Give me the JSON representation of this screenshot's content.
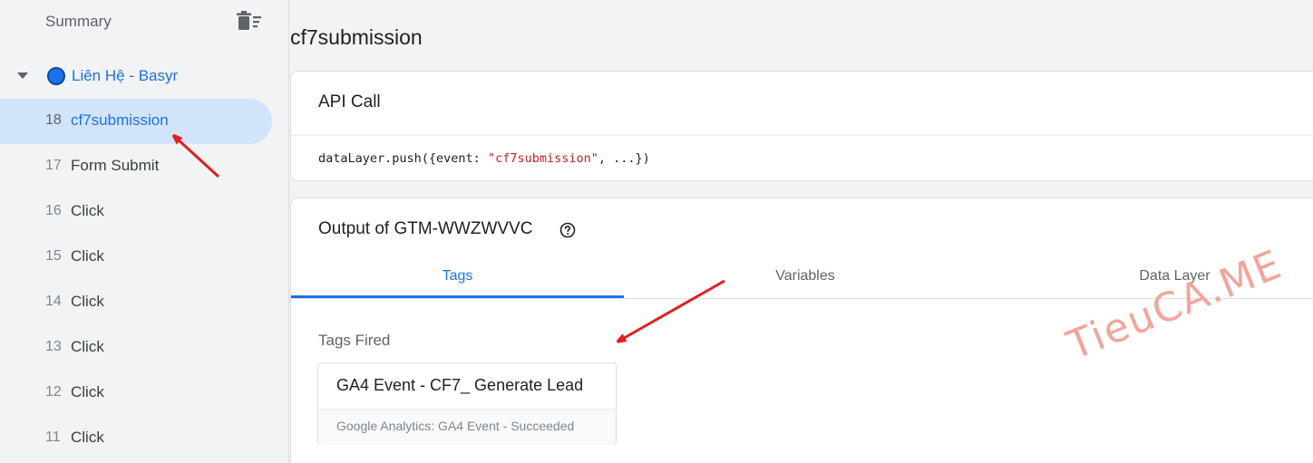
{
  "sidebar": {
    "summary_label": "Summary",
    "container": {
      "label": "Liên Hệ - Basyr",
      "accent": "#1a73e8"
    },
    "events": [
      {
        "num": "18",
        "name": "cf7submission",
        "selected": true
      },
      {
        "num": "17",
        "name": "Form Submit"
      },
      {
        "num": "16",
        "name": "Click"
      },
      {
        "num": "15",
        "name": "Click"
      },
      {
        "num": "14",
        "name": "Click"
      },
      {
        "num": "13",
        "name": "Click"
      },
      {
        "num": "12",
        "name": "Click"
      },
      {
        "num": "11",
        "name": "Click"
      }
    ]
  },
  "main": {
    "title": "cf7submission",
    "api_call": {
      "title": "API Call",
      "code_prefix": "dataLayer.push({event: ",
      "code_string": "\"cf7submission\"",
      "code_suffix": ", ...})"
    },
    "output": {
      "title": "Output of GTM-WWZWVVC",
      "tabs": [
        {
          "label": "Tags",
          "active": true
        },
        {
          "label": "Variables"
        },
        {
          "label": "Data Layer"
        }
      ],
      "tags_fired_label": "Tags Fired",
      "tag": {
        "name": "GA4 Event - CF7_ Generate Lead",
        "status": "Google Analytics: GA4 Event - Succeeded"
      }
    }
  },
  "watermark": "TieuCA.ME",
  "colors": {
    "accent": "#1a73e8",
    "selected_bg": "#d2e3fc",
    "annotation_arrow": "#e02020",
    "watermark": "#f1a59c"
  }
}
